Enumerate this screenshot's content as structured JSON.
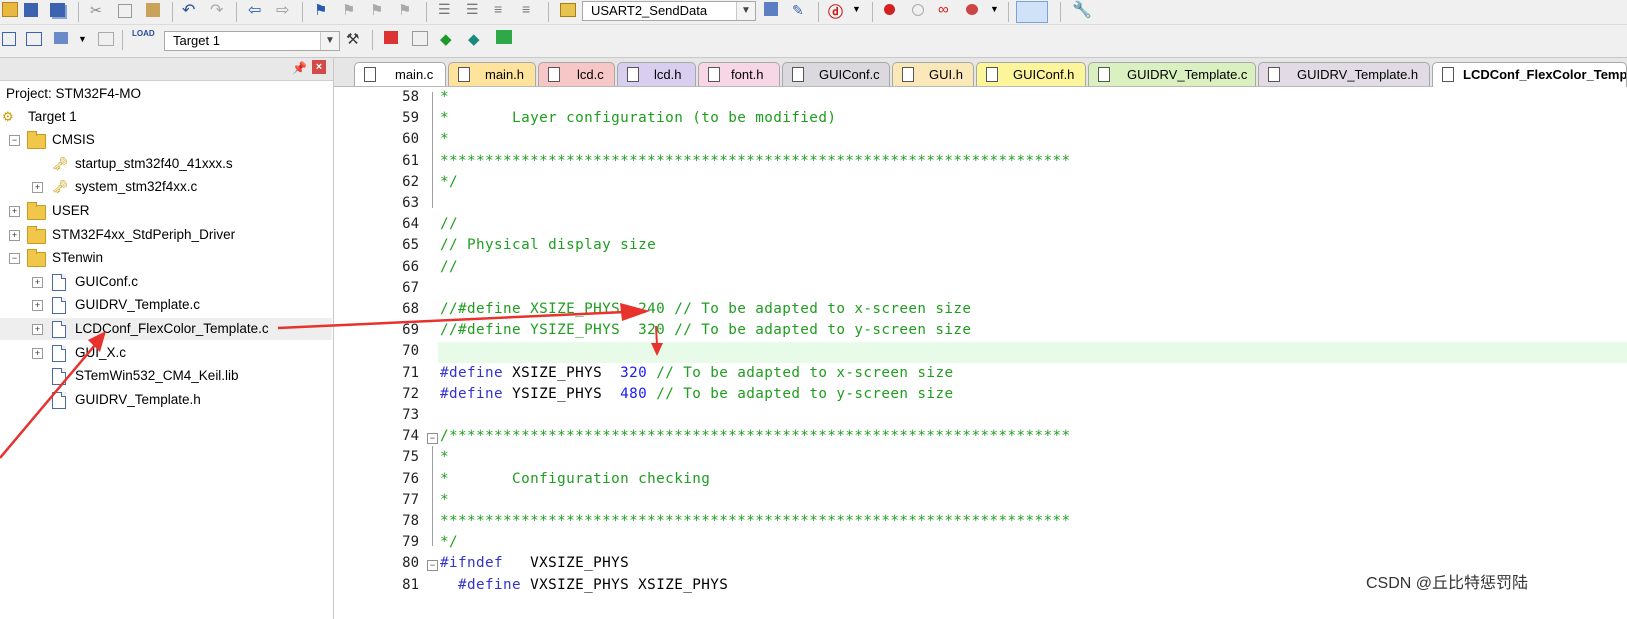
{
  "toolbar": {
    "target_combo": "USART2_SendData",
    "build_target": "Target 1",
    "build_load_label": "LOAD"
  },
  "project_panel": {
    "root": "Project: STM32F4-MO",
    "items": [
      {
        "label": "Target 1"
      },
      {
        "label": "CMSIS"
      },
      {
        "label": "startup_stm32f40_41xxx.s"
      },
      {
        "label": "system_stm32f4xx.c"
      },
      {
        "label": "USER"
      },
      {
        "label": "STM32F4xx_StdPeriph_Driver"
      },
      {
        "label": "STenwin"
      },
      {
        "label": "GUIConf.c"
      },
      {
        "label": "GUIDRV_Template.c"
      },
      {
        "label": "LCDConf_FlexColor_Template.c"
      },
      {
        "label": "GUI_X.c"
      },
      {
        "label": "STemWin532_CM4_Keil.lib"
      },
      {
        "label": "GUIDRV_Template.h"
      }
    ]
  },
  "tabs": [
    {
      "label": "main.c",
      "color": "#ffffff"
    },
    {
      "label": "main.h",
      "color": "#fde39c"
    },
    {
      "label": "lcd.c",
      "color": "#f7c6c6"
    },
    {
      "label": "lcd.h",
      "color": "#d9cdf0"
    },
    {
      "label": "font.h",
      "color": "#f7d6e6"
    },
    {
      "label": "GUIConf.c",
      "color": "#dcd8e0"
    },
    {
      "label": "GUI.h",
      "color": "#fbe8b8"
    },
    {
      "label": "GUIConf.h",
      "color": "#fdf59c"
    },
    {
      "label": "GUIDRV_Template.c",
      "color": "#dbf0c0"
    },
    {
      "label": "GUIDRV_Template.h",
      "color": "#e2dbe6"
    },
    {
      "label": "LCDConf_FlexColor_Template.c",
      "color": "#ffffff",
      "active": true
    }
  ],
  "editor": {
    "lines": [
      {
        "n": "58",
        "text": "*"
      },
      {
        "n": "59",
        "text": "*       Layer configuration (to be modified)"
      },
      {
        "n": "60",
        "text": "*"
      },
      {
        "n": "61",
        "text": "**********************************************************************"
      },
      {
        "n": "62",
        "text": "*/"
      },
      {
        "n": "63",
        "text": ""
      },
      {
        "n": "64",
        "text": "//"
      },
      {
        "n": "65",
        "text": "// Physical display size"
      },
      {
        "n": "66",
        "text": "//"
      },
      {
        "n": "67",
        "text": ""
      },
      {
        "n": "68",
        "text": "//#define XSIZE_PHYS  240 // To be adapted to x-screen size"
      },
      {
        "n": "69",
        "text": "//#define YSIZE_PHYS  320 // To be adapted to y-screen size"
      },
      {
        "n": "70",
        "text": ""
      },
      {
        "n": "71",
        "kw": "#define",
        "ident": " XSIZE_PHYS  ",
        "num": "320",
        "cm": " // To be adapted to x-screen size"
      },
      {
        "n": "72",
        "kw": "#define",
        "ident": " YSIZE_PHYS  ",
        "num": "480",
        "cm": " // To be adapted to y-screen size"
      },
      {
        "n": "73",
        "text": ""
      },
      {
        "n": "74",
        "text": "/*********************************************************************"
      },
      {
        "n": "75",
        "text": "*"
      },
      {
        "n": "76",
        "text": "*       Configuration checking"
      },
      {
        "n": "77",
        "text": "*"
      },
      {
        "n": "78",
        "text": "**********************************************************************"
      },
      {
        "n": "79",
        "text": "*/"
      },
      {
        "n": "80",
        "kw": "#ifndef",
        "ident": "   VXSIZE_PHYS"
      },
      {
        "n": "81",
        "kw": "  #define",
        "ident": " VXSIZE_PHYS XSIZE_PHYS"
      }
    ]
  },
  "watermark": "CSDN @丘比特惩罚陆",
  "colors": {
    "comment": "#1e9e1e",
    "keyword": "#3333cc",
    "number": "#1a1aff",
    "annotation_arrow": "#e8322e",
    "current_line": "#e8fbe8"
  }
}
